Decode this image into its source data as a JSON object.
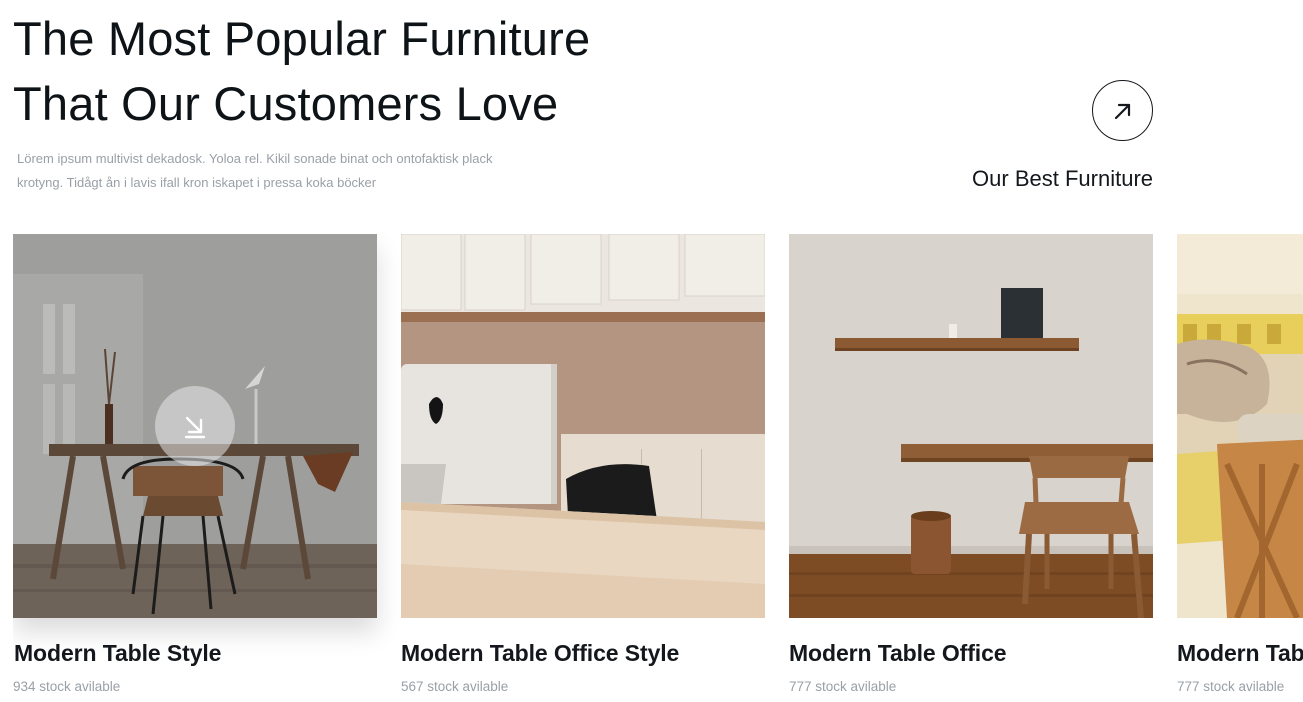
{
  "header": {
    "title_line1": "The Most Popular Furniture",
    "title_line2": "That Our Customers Love",
    "description_line1": "Lörem ipsum multivist dekadosk. Yoloa rel. Kikil sonade binat och ontofaktisk plack",
    "description_line2": "krotyng. Tidågt ån i lavis ifall kron iskapet i pressa koka böcker",
    "arrow_icon": "arrow-up-right-icon",
    "link_label": "Our Best Furniture"
  },
  "products": [
    {
      "name": "Modern Table Style",
      "stock": "934 stock avilable",
      "active": true,
      "hover_icon": "arrow-down-right-icon"
    },
    {
      "name": "Modern Table Office Style",
      "stock": "567 stock avilable"
    },
    {
      "name": "Modern Table Office",
      "stock": "777 stock avilable"
    },
    {
      "name": "Modern Table Office",
      "stock": "777 stock avilable"
    }
  ],
  "colors": {
    "text_dark": "#0d1317",
    "text_muted": "#9aa0a6",
    "background": "#ffffff"
  }
}
